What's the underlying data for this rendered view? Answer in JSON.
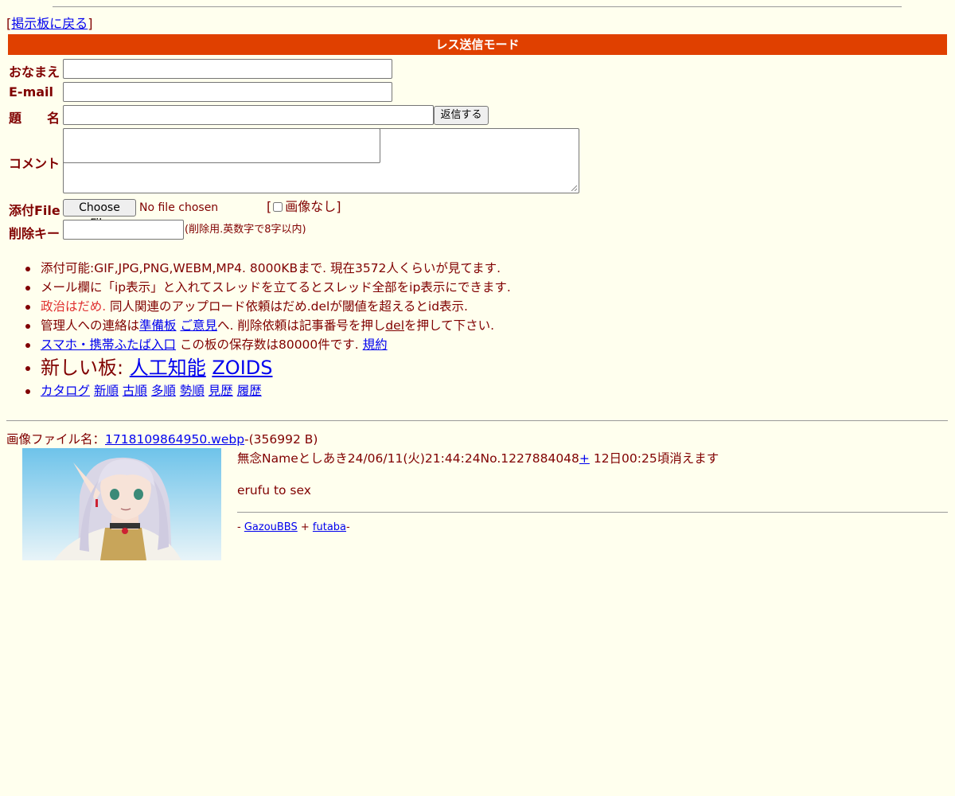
{
  "nav": {
    "bracket_open": "[",
    "back_link": "掲示板に戻る",
    "bracket_close": "]"
  },
  "form": {
    "mode_title": "レス送信モード",
    "name_label": "おなまえ",
    "email_label": "E-mail",
    "subject_label": "題　　名",
    "submit_label": "返信する",
    "comment_label": "コメント",
    "file_label": "添付File",
    "choose_file_label": "Choose File",
    "no_file_text": "No file chosen",
    "noimage_open": "[",
    "noimage_label": "画像なし",
    "noimage_close": "]",
    "delete_key_label": "削除キー",
    "delete_key_hint": "(削除用.英数字で8字以内)",
    "name_value": "",
    "email_value": "",
    "subject_value": "",
    "comment_value": "",
    "delete_key_value": ""
  },
  "rules": {
    "line1": "添付可能:GIF,JPG,PNG,WEBM,MP4. 8000KBまで. 現在3572人くらいが見てます.",
    "line2": "メール欄に「ip表示」と入れてスレッドを立てるとスレッド全部をip表示にできます.",
    "line3_red": "政治はだめ.",
    "line3_rest": " 同人関連のアップロード依頼はだめ.delが閾値を超えるとid表示.",
    "line4_a": "管理人への連絡は",
    "line4_link1": "準備板",
    "line4_link2": "ご意見",
    "line4_b": "へ. 削除依頼は記事番号を押し",
    "line4_del": "del",
    "line4_c": "を押して下さい.",
    "line5_link": "スマホ・携帯ふたば入口",
    "line5_text": " この板の保存数は80000件です. ",
    "line5_link2": "規約",
    "line6_text": "新しい板: ",
    "line6_link1": "人工知能",
    "line6_link2": "ZOIDS",
    "sort_links": [
      "カタログ",
      "新順",
      "古順",
      "多順",
      "勢順",
      "見歴",
      "履歴"
    ]
  },
  "post": {
    "file_prefix": "画像ファイル名：",
    "file_name": "1718109864950.webp",
    "file_size": "-(356992 B)",
    "header": "無念Nameとしあき24/06/11(火)21:44:24No.1227884048",
    "plus": "+",
    "expire": " 12日00:25頃消えます",
    "body": "erufu to sex"
  },
  "footer": {
    "dash1": "- ",
    "link1": "GazouBBS",
    "plus": " + ",
    "link2": "futaba",
    "dash2": "-"
  },
  "colors": {
    "background": "#ffffee",
    "text": "#800000",
    "mode_bar": "#e04000",
    "link": "#0000ee",
    "warning": "#e03030"
  }
}
